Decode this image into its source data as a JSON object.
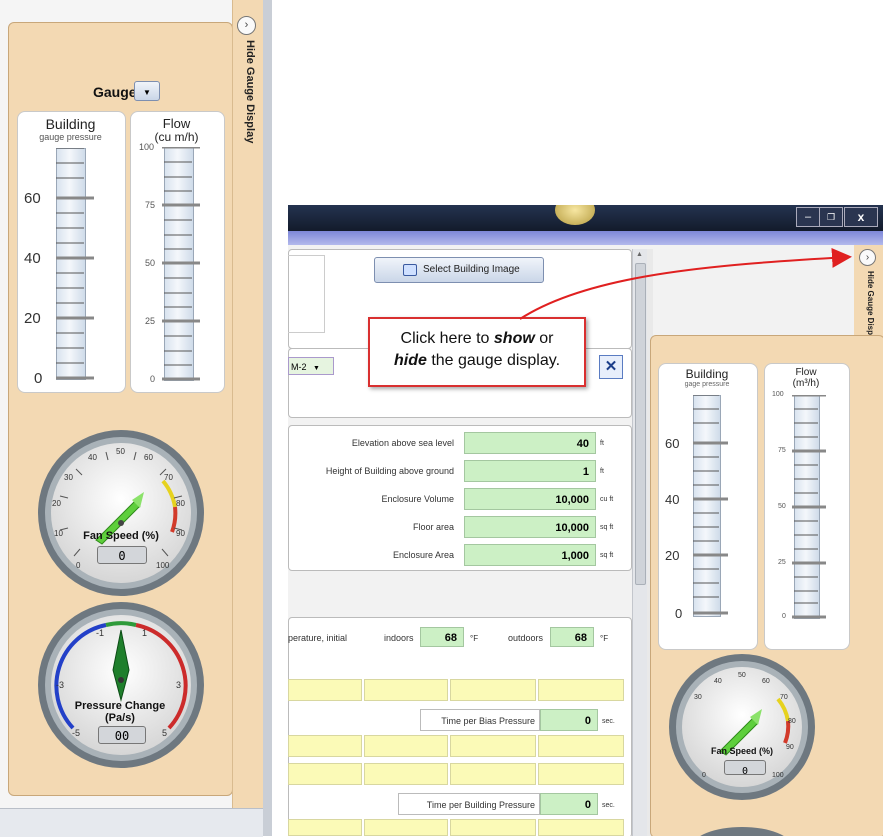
{
  "left_panel": {
    "hide_label": "Hide Gauge Display",
    "gauge_label": "Gauge",
    "building_title": "Building",
    "building_sub": "gauge pressure",
    "flow_title": "Flow",
    "flow_sub": "(cu m/h)",
    "building_ticks": [
      "60",
      "40",
      "20",
      "0"
    ],
    "flow_ticks": [
      "100",
      "75",
      "50",
      "25",
      "0"
    ],
    "fan_label": "Fan Speed (%)",
    "fan_ticks": [
      "0",
      "10",
      "20",
      "30",
      "40",
      "50",
      "60",
      "70",
      "80",
      "90",
      "100"
    ],
    "fan_digits": "0",
    "pressure_label": "Pressure Change (Pa/s)",
    "pressure_ticks": [
      "-5",
      "-3",
      "-1",
      "1",
      "3",
      "5"
    ],
    "pressure_digits": "00"
  },
  "right_window": {
    "select_building_btn": "Select Building Image",
    "dropdown_value": "M-2",
    "callout_line1": "Click here to ",
    "callout_show": "show",
    "callout_mid": " or",
    "callout_hide": "hide",
    "callout_end": " the gauge display.",
    "hide_label": "Hide Gauge Display",
    "building_rows": [
      {
        "label": "Elevation above sea level",
        "value": "40",
        "unit": "ft"
      },
      {
        "label": "Height of Building above ground",
        "value": "1",
        "unit": "ft"
      },
      {
        "label": "Enclosure Volume",
        "value": "10,000",
        "unit": "cu ft"
      },
      {
        "label": "Floor area",
        "value": "10,000",
        "unit": "sq ft"
      },
      {
        "label": "Enclosure Area",
        "value": "1,000",
        "unit": "sq ft"
      }
    ],
    "temp_label": "perature, initial",
    "indoors_label": "indoors",
    "indoors_value": "68",
    "outdoors_label": "outdoors",
    "outdoors_value": "68",
    "temp_unit": "°F",
    "bias_label": "Time per Bias Pressure",
    "bias_value": "0",
    "bias_unit": "sec.",
    "building_pressure_label": "Time per Building Pressure",
    "building_pressure_value": "0",
    "building_pressure_unit": "sec.",
    "gauge_building_title": "Building",
    "gauge_building_sub": "gage pressure",
    "gauge_flow_title": "Flow",
    "gauge_flow_sub": "(m³/h)",
    "gauge_building_ticks": [
      "60",
      "40",
      "20",
      "0"
    ],
    "gauge_flow_ticks": [
      "100",
      "75",
      "50",
      "25",
      "0"
    ],
    "fan_label": "Fan Speed (%)",
    "fan_ticks": [
      "0",
      "30",
      "40",
      "50",
      "60",
      "70",
      "80",
      "90",
      "100"
    ],
    "fan_digits": "0"
  },
  "colors": {
    "panel": "#f3d9b3",
    "field_green": "#ccf0c5",
    "field_yellow": "#fbfab7",
    "titlebar": "#1b2538",
    "callout_border": "#d93030",
    "arrow": "#e02020"
  }
}
